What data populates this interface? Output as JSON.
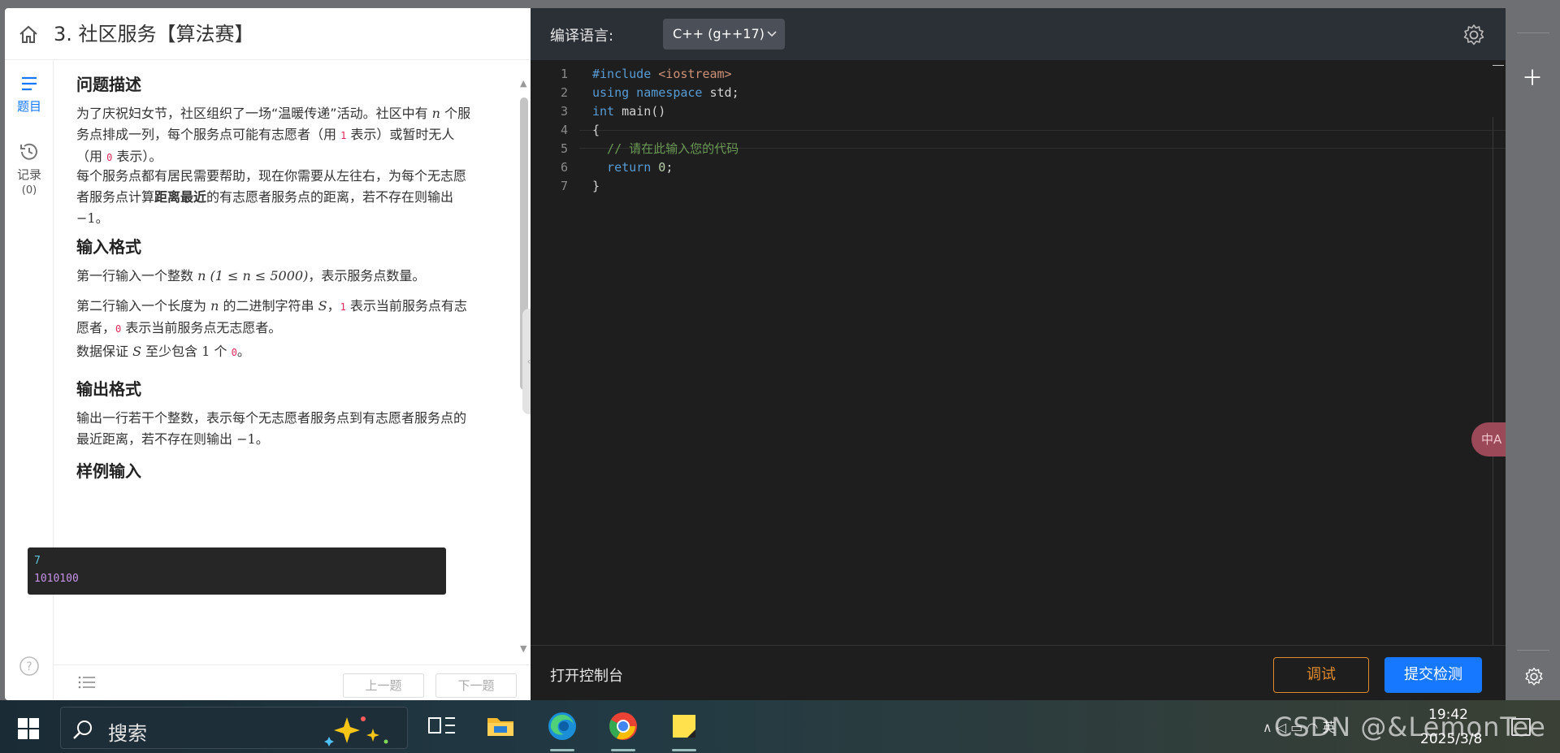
{
  "left": {
    "title": "3. 社区服务【算法赛】",
    "nav": [
      {
        "label": "题目",
        "count": ""
      },
      {
        "label": "记录",
        "count": "(0)"
      }
    ],
    "sections": {
      "desc_title": "问题描述",
      "desc_p1_a": "为了庆祝妇女节，社区组织了一场“温暖传递”活动。社区中有 ",
      "desc_p1_n": "n",
      "desc_p1_b": " 个服",
      "desc_p1_c": "务点排成一列，每个服务点可能有志愿者（用 ",
      "desc_p1_one": "1",
      "desc_p1_d": " 表示）或暂时无人",
      "desc_p1_e": "（用 ",
      "desc_p1_zero": "0",
      "desc_p1_f": " 表示）。",
      "desc_p2_a": "每个服务点都有居民需要帮助，现在你需要从左往右，为每个无志愿",
      "desc_p2_b": "者服务点计算",
      "desc_p2_bold": "距离最近",
      "desc_p2_c": "的有志愿者服务点的距离，若不存在则输出",
      "desc_p2_d": "−1",
      "desc_p2_e": "。",
      "input_title": "输入格式",
      "input_p1_a": "第一行输入一个整数 ",
      "input_p1_math": "n (1 ≤ n ≤ 5000)",
      "input_p1_b": "，表示服务点数量。",
      "input_p2_a": "第二行输入一个长度为 ",
      "input_p2_n": "n",
      "input_p2_b": " 的二进制字符串 ",
      "input_p2_s": "S",
      "input_p2_c": "，",
      "input_p2_one": "1",
      "input_p2_d": " 表示当前服务点有志",
      "input_p2_e": "愿者，",
      "input_p2_zero": "0",
      "input_p2_f": " 表示当前服务点无志愿者。",
      "input_p3_a": "数据保证 ",
      "input_p3_s": "S",
      "input_p3_b": " 至少包含 ",
      "input_p3_one": "1",
      "input_p3_c": " 个 ",
      "input_p3_zero": "0",
      "input_p3_d": "。",
      "output_title": "输出格式",
      "output_p1": "输出一行若干个整数，表示每个无志愿者服务点到有志愿者服务点的",
      "output_p2_a": "最近距离，若不存在则输出 ",
      "output_p2_neg": "−1",
      "output_p2_b": "。",
      "sample_title": "样例输入"
    },
    "sample_input": [
      "7",
      "1010100"
    ],
    "footer": {
      "prev": "上一题",
      "next": "下一题"
    }
  },
  "editor": {
    "lang_label": "编译语言:",
    "lang_value": "C++ (g++17)",
    "line_numbers": [
      "1",
      "2",
      "3",
      "4",
      "5",
      "6",
      "7"
    ],
    "code": {
      "l1_pp": "#include",
      "l1_inc": " <iostream>",
      "l2_kw1": "using",
      "l2_kw2": " namespace",
      "l2_rest": " std;",
      "l3_kw": "int",
      "l3_rest": " main()",
      "l4": "{",
      "l5": "  // 请在此输入您的代码",
      "l6_kw": "  return",
      "l6_num": " 0",
      "l6_rest": ";",
      "l7": "}"
    },
    "translate": "中A",
    "console": "打开控制台",
    "debug": "调试",
    "submit": "提交检测"
  },
  "taskbar": {
    "search": "搜索",
    "time": "19:42",
    "date": "2025/3/8",
    "tray": "∧  ◁ ▭ ◠ 英",
    "watermark": "CSDN @&LemonTee"
  }
}
